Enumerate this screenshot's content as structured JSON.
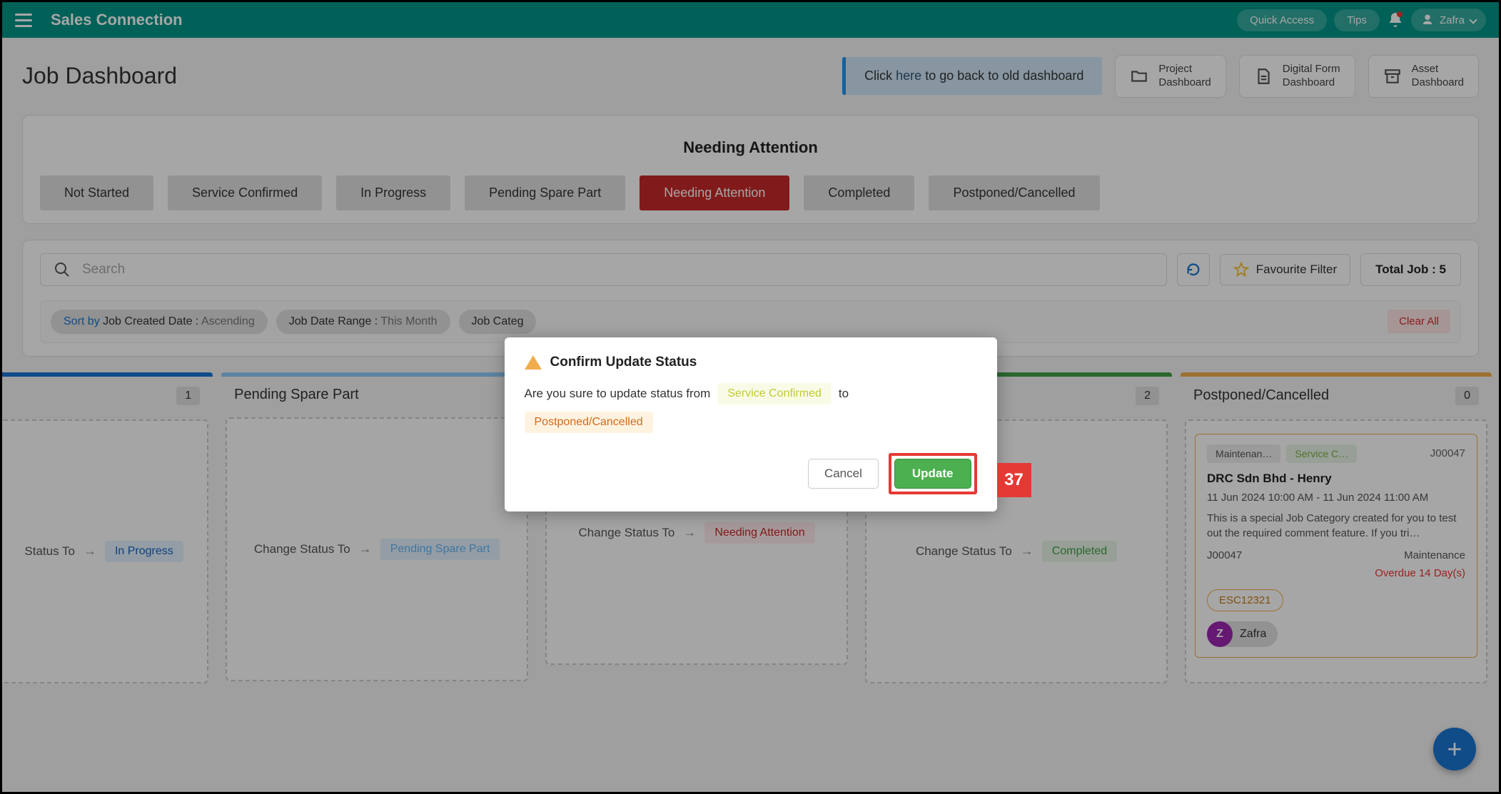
{
  "topbar": {
    "brand": "Sales Connection",
    "quick_access": "Quick Access",
    "tips": "Tips",
    "user": "Zafra"
  },
  "header": {
    "title": "Job Dashboard",
    "old_pre": "Click ",
    "old_link": "here",
    "old_post": " to go back to old dashboard",
    "btns": [
      {
        "line1": "Project",
        "line2": "Dashboard"
      },
      {
        "line1": "Digital Form",
        "line2": "Dashboard"
      },
      {
        "line1": "Asset",
        "line2": "Dashboard"
      }
    ]
  },
  "section_title": "Needing Attention",
  "tabs": [
    "Not Started",
    "Service Confirmed",
    "In Progress",
    "Pending Spare Part",
    "Needing Attention",
    "Completed",
    "Postponed/Cancelled"
  ],
  "active_tab": 4,
  "search": {
    "placeholder": "Search"
  },
  "fav": "Favourite Filter",
  "total_label": "Total Job : ",
  "total_val": "5",
  "filters": {
    "sort_label": "Sort by ",
    "sort_field": "Job Created Date : ",
    "sort_dir": "Ascending",
    "range_label": "Job Date Range : ",
    "range_val": "This Month",
    "cat_label": "Job Categ",
    "clear": "Clear All"
  },
  "columns": [
    {
      "title": "",
      "count": "1",
      "bar": "bc-blue",
      "change_label": "Status To",
      "status": "In Progress",
      "pill_bg": "#e3f2fd",
      "pill_fg": "#1565c0"
    },
    {
      "title": "Pending Spare Part",
      "count": "",
      "bar": "bc-lblue",
      "change_label": "Change Status To",
      "status": "Pending Spare Part",
      "pill_bg": "#e3f2fd",
      "pill_fg": "#64b5f6"
    },
    {
      "title": "",
      "count": "",
      "bar": "bc-dorange",
      "change_label": "Change Status To",
      "status": "Needing Attention",
      "pill_bg": "#ffebee",
      "pill_fg": "#c62828"
    },
    {
      "title": "",
      "count": "2",
      "bar": "bc-green",
      "change_label": "Change Status To",
      "status": "Completed",
      "pill_bg": "#e8f5e9",
      "pill_fg": "#43a047"
    },
    {
      "title": "Postponed/Cancelled",
      "count": "0",
      "bar": "bc-orange",
      "card": true
    }
  ],
  "job": {
    "chip1": "Maintenan…",
    "chip2": "Service C…",
    "id_top": "J00047",
    "title": "DRC Sdn Bhd - Henry",
    "date": "11 Jun 2024 10:00 AM - 11 Jun 2024 11:00 AM",
    "desc": "This is a special Job Category created for you to test out the required comment feature. If you tri…",
    "id_bottom": "J00047",
    "type": "Maintenance",
    "overdue": "Overdue 14 Day(s)",
    "esc": "ESC12321",
    "avatar_letter": "Z",
    "avatar_name": "Zafra"
  },
  "modal": {
    "title": "Confirm Update Status",
    "body_pre": "Are you sure to update status from",
    "from": "Service Confirmed",
    "to_word": "to",
    "to": "Postponed/Cancelled",
    "cancel": "Cancel",
    "update": "Update",
    "step": "37",
    "from_bg": "#f9fbe7",
    "from_fg": "#c0ca33",
    "to_bg": "#fff3e0",
    "to_fg": "#d2691e"
  }
}
